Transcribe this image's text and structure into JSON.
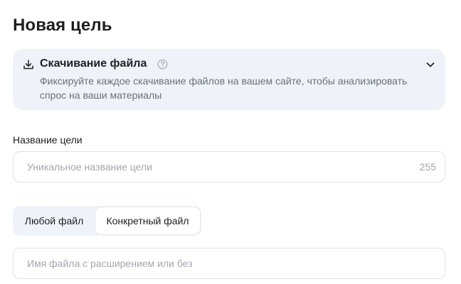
{
  "page": {
    "title": "Новая цель"
  },
  "goal_type_card": {
    "icon": "download-icon",
    "title": "Скачивание файла",
    "help_icon": "question-circle-icon",
    "expand_icon": "chevron-down-icon",
    "description": "Фиксируйте каждое скачивание файлов на вашем сайте, чтобы анализировать спрос на ваши материалы"
  },
  "goal_name": {
    "label": "Название цели",
    "value": "",
    "placeholder": "Уникальное название цели",
    "char_limit": "255"
  },
  "file_mode": {
    "options": [
      {
        "label": "Любой файл",
        "selected": false
      },
      {
        "label": "Конкретный файл",
        "selected": true
      }
    ]
  },
  "file_name": {
    "value": "",
    "placeholder": "Имя файла с расширением или без"
  },
  "colors": {
    "card_background": "#eff3f9",
    "text_primary": "#1f1f1f",
    "text_secondary": "#6b6f78",
    "placeholder": "#a3a7ae",
    "border": "#dfe2e7"
  }
}
